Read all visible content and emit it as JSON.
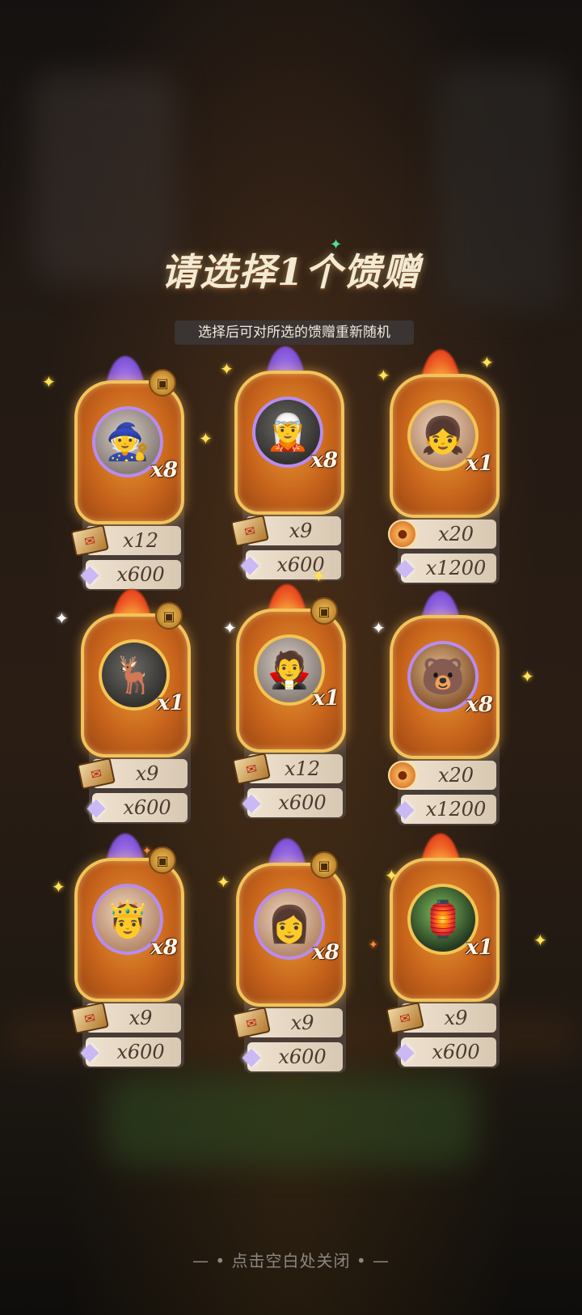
{
  "title": "请选择1个馈赠",
  "subtitle": "选择后可对所选的馈赠重新随机",
  "close_hint": "— • 点击空白处关闭 • —",
  "cards": [
    {
      "count": "x8",
      "row1": "x12",
      "row2": "x600",
      "row1_icon": "letter-icon",
      "row2_icon": "diamond-icon",
      "flame": "purple"
    },
    {
      "count": "x8",
      "row1": "x9",
      "row2": "x600",
      "row1_icon": "letter-icon",
      "row2_icon": "diamond-icon",
      "flame": "purple"
    },
    {
      "count": "x1",
      "row1": "x20",
      "row2": "x1200",
      "row1_icon": "coin-icon",
      "row2_icon": "diamond-icon",
      "flame": "red"
    },
    {
      "count": "x1",
      "row1": "x9",
      "row2": "x600",
      "row1_icon": "letter-icon",
      "row2_icon": "diamond-icon",
      "flame": "red"
    },
    {
      "count": "x1",
      "row1": "x12",
      "row2": "x600",
      "row1_icon": "letter-icon",
      "row2_icon": "diamond-icon",
      "flame": "red"
    },
    {
      "count": "x8",
      "row1": "x20",
      "row2": "x1200",
      "row1_icon": "coin-icon",
      "row2_icon": "diamond-icon",
      "flame": "purple"
    },
    {
      "count": "x8",
      "row1": "x9",
      "row2": "x600",
      "row1_icon": "letter-icon",
      "row2_icon": "diamond-icon",
      "flame": "purple"
    },
    {
      "count": "x8",
      "row1": "x9",
      "row2": "x600",
      "row1_icon": "letter-icon",
      "row2_icon": "diamond-icon",
      "flame": "purple"
    },
    {
      "count": "x1",
      "row1": "x9",
      "row2": "x600",
      "row1_icon": "letter-icon",
      "row2_icon": "diamond-icon",
      "flame": "red"
    }
  ]
}
